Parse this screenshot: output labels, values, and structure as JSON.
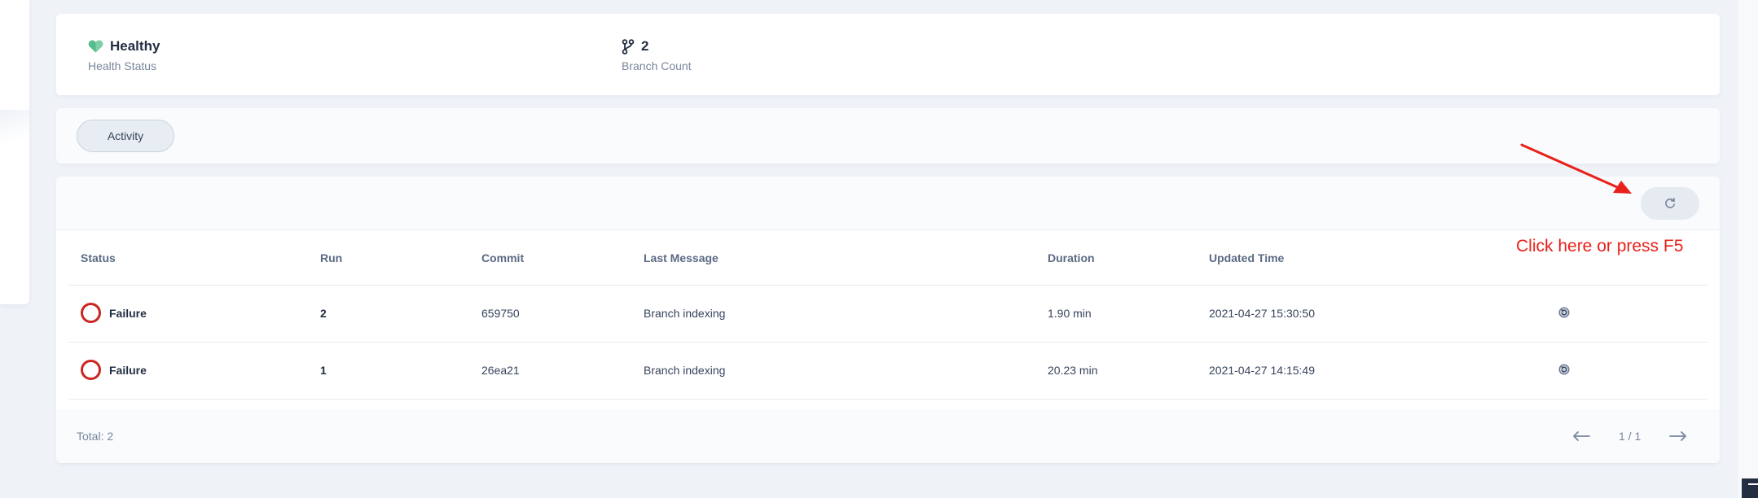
{
  "summary": {
    "health_value": "Healthy",
    "health_label": "Health Status",
    "branch_value": "2",
    "branch_label": "Branch Count"
  },
  "tabs": [
    {
      "label": "Activity",
      "active": true
    }
  ],
  "table": {
    "columns": [
      "Status",
      "Run",
      "Commit",
      "Last Message",
      "Duration",
      "Updated Time"
    ],
    "rows": [
      {
        "status": "Failure",
        "run": "2",
        "commit": "659750",
        "message": "Branch indexing",
        "duration": "1.90 min",
        "updated": "2021-04-27 15:30:50"
      },
      {
        "status": "Failure",
        "run": "1",
        "commit": "26ea21",
        "message": "Branch indexing",
        "duration": "20.23 min",
        "updated": "2021-04-27 14:15:49"
      }
    ]
  },
  "footer": {
    "total": "Total: 2",
    "page": "1 / 1"
  },
  "annotation": {
    "text": "Click here or press F5",
    "color": "#e8211a"
  },
  "icons": {
    "health": "heart-icon",
    "branch": "git-branch-icon",
    "refresh": "refresh-icon",
    "failure": "failure-status-icon",
    "rerun": "rerun-icon",
    "prev": "arrow-left-icon",
    "next": "arrow-right-icon"
  },
  "colors": {
    "background": "#eff3f8",
    "failure": "#ca2621",
    "healthy": "#55bc8a",
    "text": "#242e42",
    "muted": "#79879c"
  }
}
